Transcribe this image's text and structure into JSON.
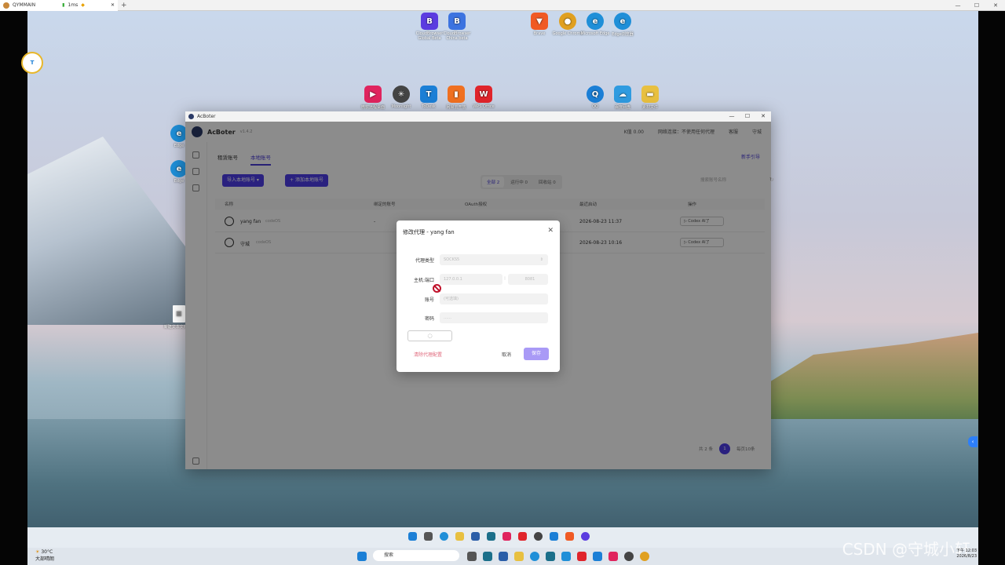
{
  "remote_tab": {
    "title": "QYMMAIN",
    "speed": "1ms",
    "new_tab": "+"
  },
  "remote_controls": {
    "min": "—",
    "max": "☐",
    "close": "✕"
  },
  "desktop_icons": [
    {
      "label": "CloudBrowser Global Beta",
      "color": "#5b3ce0"
    },
    {
      "label": "CloudBrowser China beta",
      "color": "#3c73e0"
    },
    {
      "label": "Brave",
      "color": "#f05a24"
    },
    {
      "label": "Google Chrome",
      "color": "#e0a020"
    },
    {
      "label": "Microsoft Edge",
      "color": "#1f8fd8"
    },
    {
      "label": "Edge浏览器",
      "color": "#1f8fd8"
    },
    {
      "label": "微软远程桌面",
      "color": "#e0245e"
    },
    {
      "label": "Moonlight",
      "color": "#444444"
    },
    {
      "label": "ToDesk",
      "color": "#1b7fd6"
    },
    {
      "label": "网易云开放",
      "color": "#f07020"
    },
    {
      "label": "WPS Office",
      "color": "#e0242b"
    },
    {
      "label": "QQ",
      "color": "#1b7fd6"
    },
    {
      "label": "百度网盘",
      "color": "#2f9be0"
    },
    {
      "label": "素材文件",
      "color": "#e8c040"
    },
    {
      "label": "Edge",
      "color": "#1f8fd8"
    },
    {
      "label": "Edge",
      "color": "#1f8fd8"
    },
    {
      "label": "新建文本文档.txt",
      "color": "#ffffff"
    }
  ],
  "app": {
    "window_title": "AcBoter",
    "name": "AcBoter",
    "version": "v1.4.2",
    "balance": "K值 0.00",
    "network": "网络连接：不使用任何代理",
    "service": "客服",
    "user": "守城",
    "tabs": [
      "租赁账号",
      "本地账号"
    ],
    "guide": "新手引导",
    "import_btn": "导入本地账号",
    "add_btn": "添加本地账号",
    "filters": [
      "全部 2",
      "运行中 0",
      "回收站 0"
    ],
    "search_placeholder": "搜索账号名称",
    "columns": [
      "名称",
      "绑定的账号",
      "OAuth授权",
      "最近启动",
      "操作"
    ],
    "rows": [
      {
        "name": "yang fan",
        "tag": "codeOS",
        "bound": "-",
        "last": "2026-08-23 11:37",
        "action": "▷ Codex AI了"
      },
      {
        "name": "守城",
        "tag": "codeOS",
        "bound": "",
        "last": "2026-08-23 10:16",
        "action": "▷ Codex AI了"
      }
    ],
    "pager": {
      "total": "共 2 条",
      "page": "1",
      "per_page": "每页10条"
    }
  },
  "modal": {
    "title": "修改代理 - yang fan",
    "fields": [
      {
        "label": "代理类型",
        "value": "SOCKS5"
      },
      {
        "label": "主机:端口",
        "value": "127.0.0.1",
        "port": "8081",
        "sep": ":"
      },
      {
        "label": "账号",
        "value": "(可选填)"
      },
      {
        "label": "密码",
        "value": "……"
      }
    ],
    "test_label": "◌",
    "clear": "清除代理配置",
    "cancel": "取消",
    "save": "保存"
  },
  "taskbar": {
    "weather_temp": "30°C",
    "weather_desc": "大部晴朗",
    "search": "搜索",
    "clock_time": "下午 12:03",
    "clock_date": "2026/8/23",
    "watermark": "CSDN @守城小轩"
  }
}
